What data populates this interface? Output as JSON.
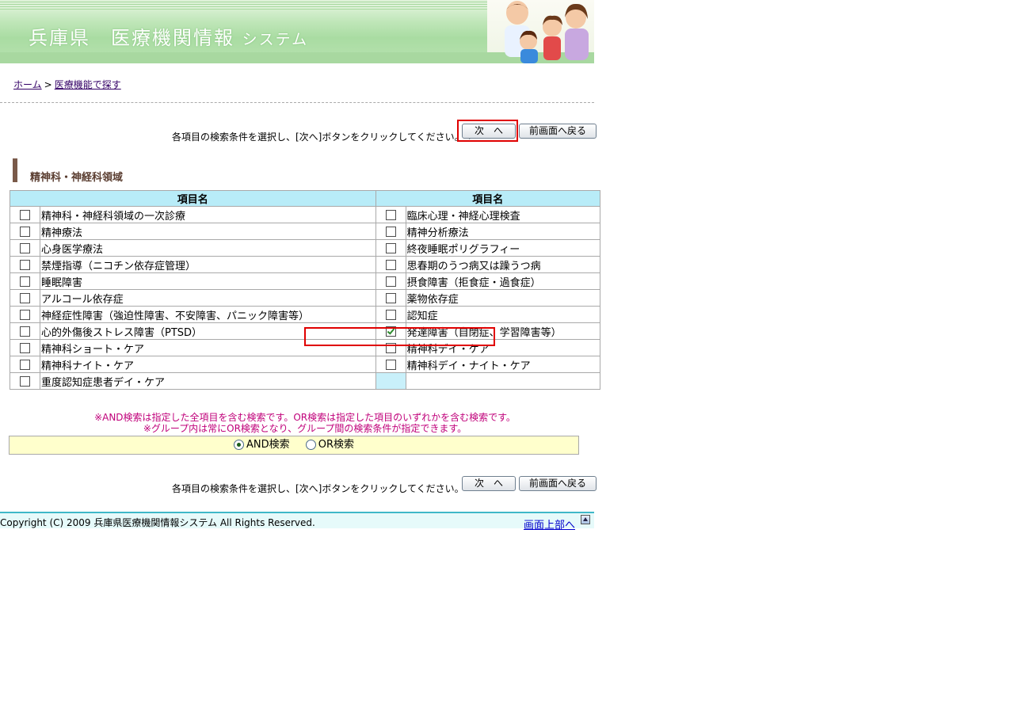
{
  "header": {
    "title_main": "兵庫県　医療機関情報",
    "title_sub": "システム"
  },
  "breadcrumb": {
    "home": "ホーム",
    "separator": ">",
    "current": "医療機能で探す"
  },
  "instruction": "各項目の検索条件を選択し、[次へ]ボタンをクリックしてください。→",
  "buttons": {
    "next": "次　へ",
    "back": "前画面へ戻る"
  },
  "section_title": "精神科・神経科領域",
  "table": {
    "col_header_left": "項目名",
    "col_header_right": "項目名",
    "rows": [
      {
        "left": "精神科・神経科領域の一次診療",
        "left_checked": false,
        "right": "臨床心理・神経心理検査",
        "right_checked": false
      },
      {
        "left": "精神療法",
        "left_checked": false,
        "right": "精神分析療法",
        "right_checked": false
      },
      {
        "left": "心身医学療法",
        "left_checked": false,
        "right": "終夜睡眠ポリグラフィー",
        "right_checked": false
      },
      {
        "left": "禁煙指導（ニコチン依存症管理）",
        "left_checked": false,
        "right": "思春期のうつ病又は躁うつ病",
        "right_checked": false
      },
      {
        "left": "睡眠障害",
        "left_checked": false,
        "right": "摂食障害（拒食症・過食症）",
        "right_checked": false
      },
      {
        "left": "アルコール依存症",
        "left_checked": false,
        "right": "薬物依存症",
        "right_checked": false
      },
      {
        "left": "神経症性障害（強迫性障害、不安障害、パニック障害等）",
        "left_checked": false,
        "right": "認知症",
        "right_checked": false
      },
      {
        "left": "心的外傷後ストレス障害（PTSD）",
        "left_checked": false,
        "right": "発達障害（自閉症、学習障害等）",
        "right_checked": true
      },
      {
        "left": "精神科ショート・ケア",
        "left_checked": false,
        "right": "精神科デイ・ケア",
        "right_checked": false
      },
      {
        "left": "精神科ナイト・ケア",
        "left_checked": false,
        "right": "精神科デイ・ナイト・ケア",
        "right_checked": false
      },
      {
        "left": "重度認知症患者デイ・ケア",
        "left_checked": false,
        "right": "",
        "right_checked": null
      }
    ]
  },
  "notes": {
    "line1": "※AND検索は指定した全項目を含む検索です。OR検索は指定した項目のいずれかを含む検索です。",
    "line2": "※グループ内は常にOR検索となり、グループ間の検索条件が指定できます。"
  },
  "search_mode": {
    "and_label": "AND検索",
    "or_label": "OR検索",
    "selected": "AND"
  },
  "footer": {
    "copyright": "Copyright (C) 2009 兵庫県医療機関情報システム All Rights Reserved.",
    "to_top": "画面上部へ"
  },
  "colors": {
    "header_green": "#a9dca2",
    "table_header": "#b8ecf8",
    "note_magenta": "#c0007a",
    "highlight_red": "#e00000",
    "andor_bg": "#ffffcc"
  }
}
